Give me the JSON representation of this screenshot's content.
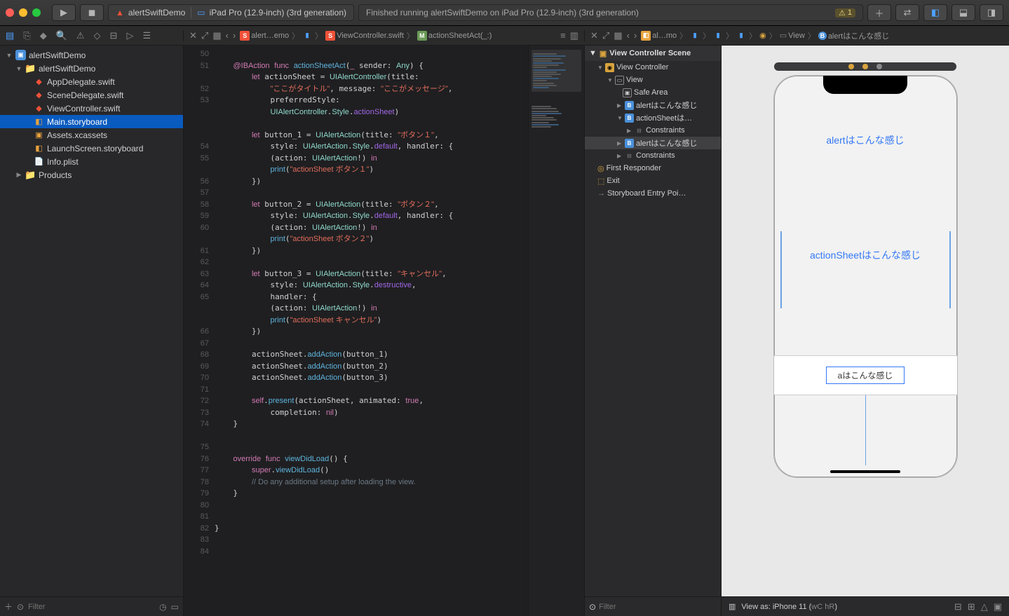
{
  "toolbar": {
    "scheme_app": "alertSwiftDemo",
    "scheme_device": "iPad Pro (12.9-inch) (3rd generation)",
    "status": "Finished running alertSwiftDemo on iPad Pro (12.9-inch) (3rd generation)",
    "warnings": "1"
  },
  "nav": {
    "project": "alertSwiftDemo",
    "group": "alertSwiftDemo",
    "files": [
      "AppDelegate.swift",
      "SceneDelegate.swift",
      "ViewController.swift",
      "Main.storyboard",
      "Assets.xcassets",
      "LaunchScreen.storyboard",
      "Info.plist"
    ],
    "products": "Products",
    "filter_ph": "Filter"
  },
  "crumbs_editor": {
    "a": "alert…emo",
    "b": "ViewController.swift",
    "c": "actionSheetAct(_:)"
  },
  "crumbs_ib": {
    "a": "al…mo",
    "b": "View",
    "c": "alertはこんな感じ"
  },
  "gutter": [
    "50",
    "51",
    "",
    "52",
    "53",
    "",
    "",
    "",
    "54",
    "55",
    "",
    "56",
    "57",
    "58",
    "59",
    "60",
    "",
    "61",
    "62",
    "63",
    "64",
    "65",
    "",
    "",
    "66",
    "67",
    "68",
    "69",
    "70",
    "71",
    "72",
    "73",
    "74",
    "",
    "75",
    "76",
    "77",
    "78",
    "79",
    "80",
    "81",
    "82",
    "83",
    "84"
  ],
  "outline": {
    "scene": "View Controller Scene",
    "vc": "View Controller",
    "view": "View",
    "safe": "Safe Area",
    "b1": "alertはこんな感じ",
    "b2": "actionSheetは…",
    "c1": "Constraints",
    "b3": "alertはこんな感じ",
    "c2": "Constraints",
    "fr": "First Responder",
    "exit": "Exit",
    "entry": "Storyboard Entry Poi…",
    "filter_ph": "Filter"
  },
  "ib": {
    "btn1": "alertはこんな感じ",
    "btn2": "actionSheetはこんな感じ",
    "btn3": "aはこんな感じ",
    "viewas": "View as: iPhone 11 (",
    "wc": "wC",
    "hr": "hR",
    "close": ")"
  }
}
